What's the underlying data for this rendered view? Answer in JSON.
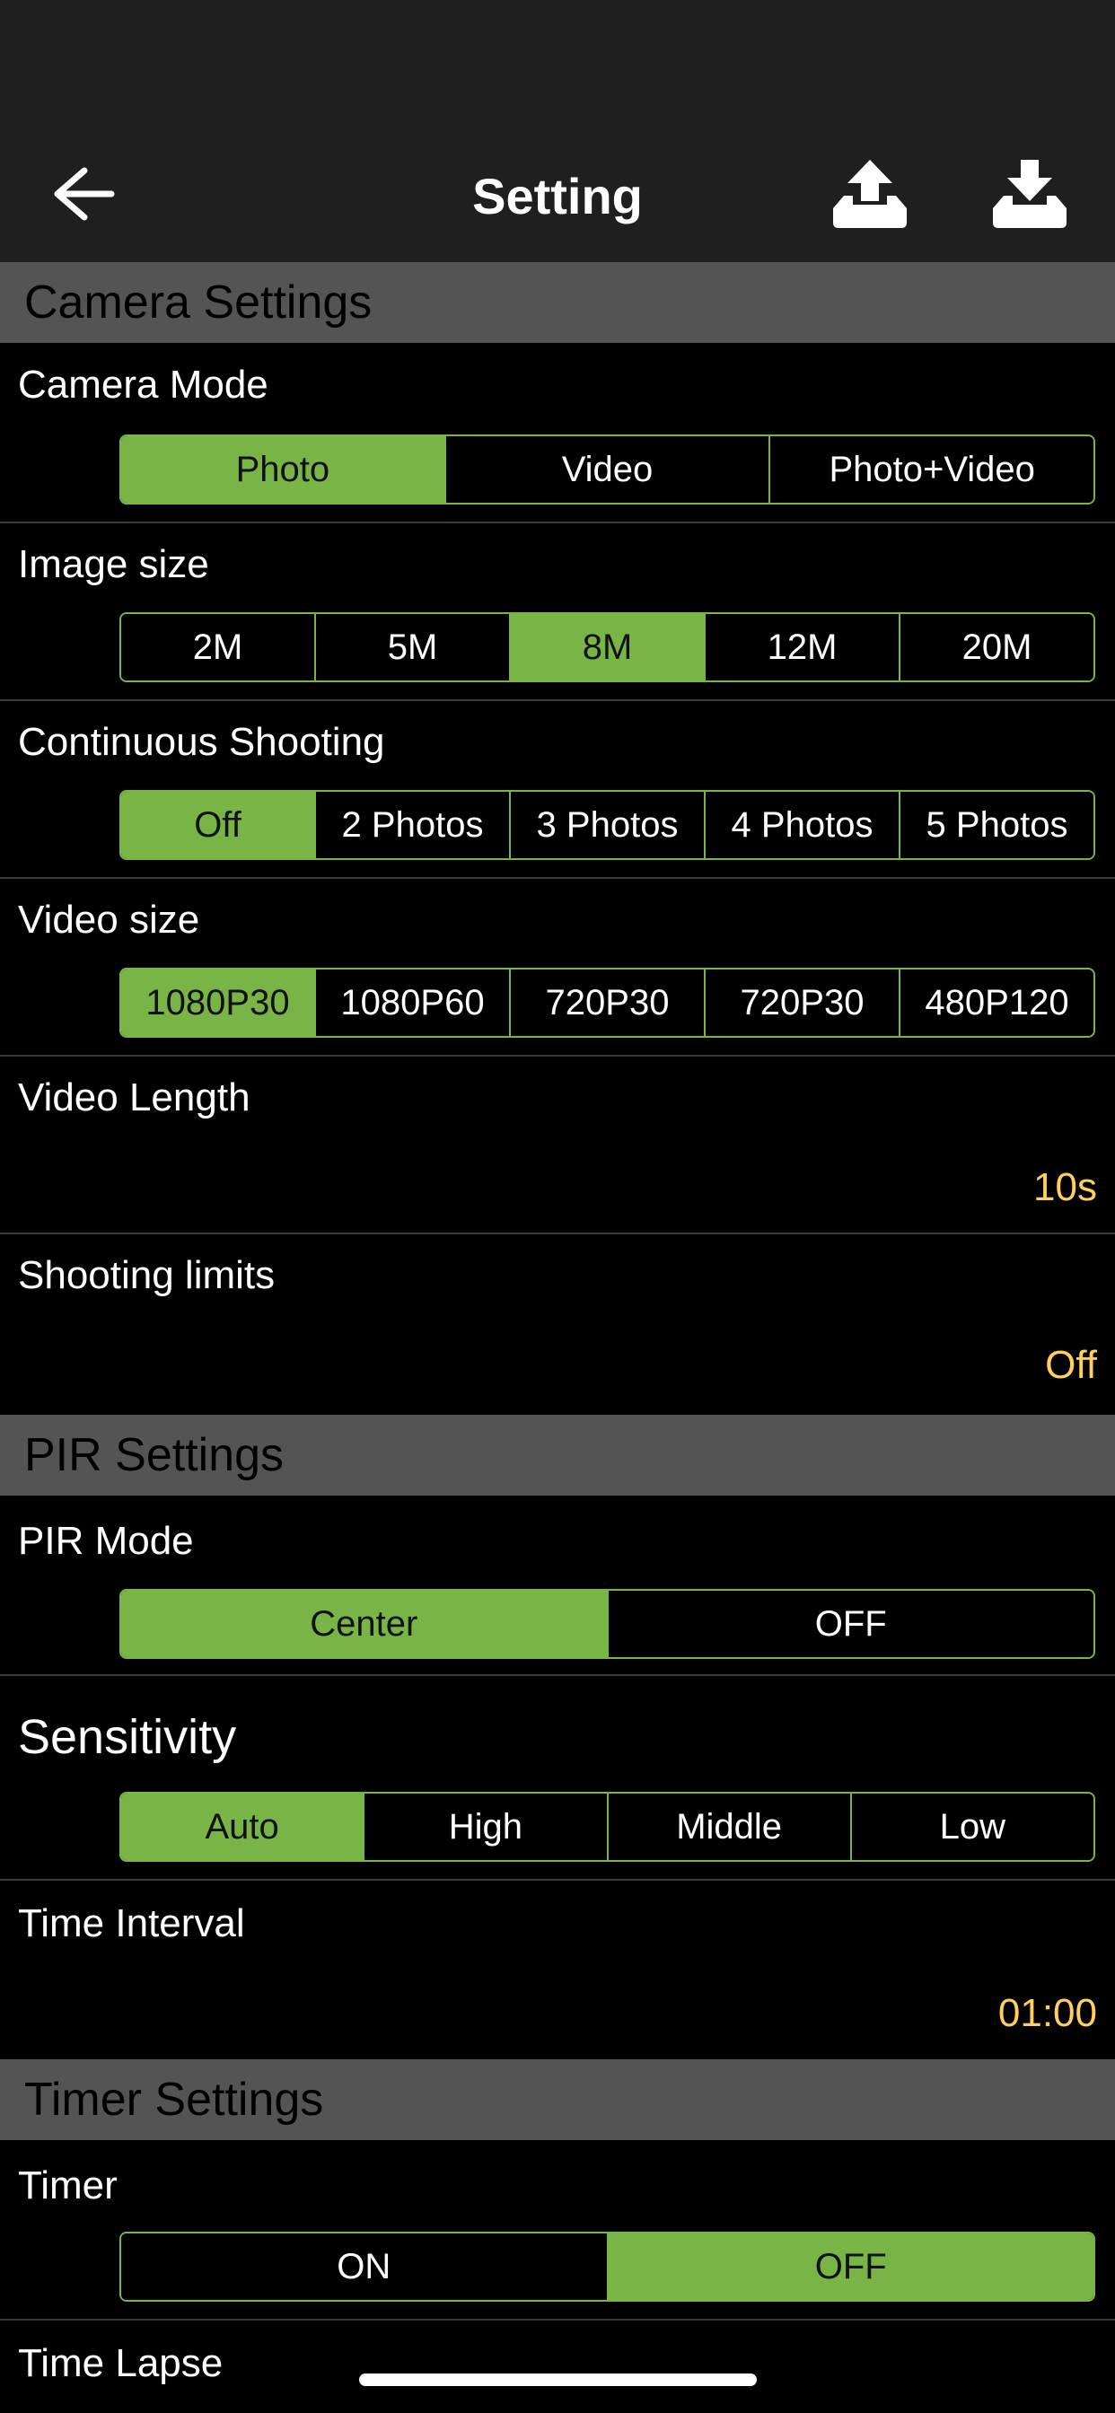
{
  "header": {
    "title": "Setting",
    "back_icon": "arrow-left-icon",
    "upload_icon": "upload-tray-icon",
    "download_icon": "download-tray-icon"
  },
  "camera_settings": {
    "title": "Camera Settings",
    "camera_mode": {
      "label": "Camera Mode",
      "options": [
        "Photo",
        "Video",
        "Photo+Video"
      ],
      "selected": "Photo"
    },
    "image_size": {
      "label": "Image size",
      "options": [
        "2M",
        "5M",
        "8M",
        "12M",
        "20M"
      ],
      "selected": "8M"
    },
    "continuous_shooting": {
      "label": "Continuous Shooting",
      "options": [
        "Off",
        "2 Photos",
        "3 Photos",
        "4 Photos",
        "5 Photos"
      ],
      "selected": "Off"
    },
    "video_size": {
      "label": "Video size",
      "options": [
        "1080P30",
        "1080P60",
        "720P30",
        "720P30",
        "480P120"
      ],
      "selected": "1080P30"
    },
    "video_length": {
      "label": "Video Length",
      "value": "10s"
    },
    "shooting_limits": {
      "label": "Shooting limits",
      "value": "Off"
    }
  },
  "pir_settings": {
    "title": "PIR Settings",
    "pir_mode": {
      "label": "PIR Mode",
      "options": [
        "Center",
        "OFF"
      ],
      "selected": "Center"
    },
    "sensitivity": {
      "label": "Sensitivity",
      "options": [
        "Auto",
        "High",
        "Middle",
        "Low"
      ],
      "selected": "Auto"
    },
    "time_interval": {
      "label": "Time Interval",
      "value": "01:00"
    }
  },
  "timer_settings": {
    "title": "Timer Settings",
    "timer": {
      "label": "Timer",
      "options": [
        "ON",
        "OFF"
      ],
      "selected": "OFF"
    },
    "time_lapse": {
      "label": "Time Lapse"
    }
  },
  "colors": {
    "accent": "#78b446",
    "value_text": "#ffd15c",
    "section_bg": "#545454",
    "bar_bg": "#1f1f1f"
  }
}
